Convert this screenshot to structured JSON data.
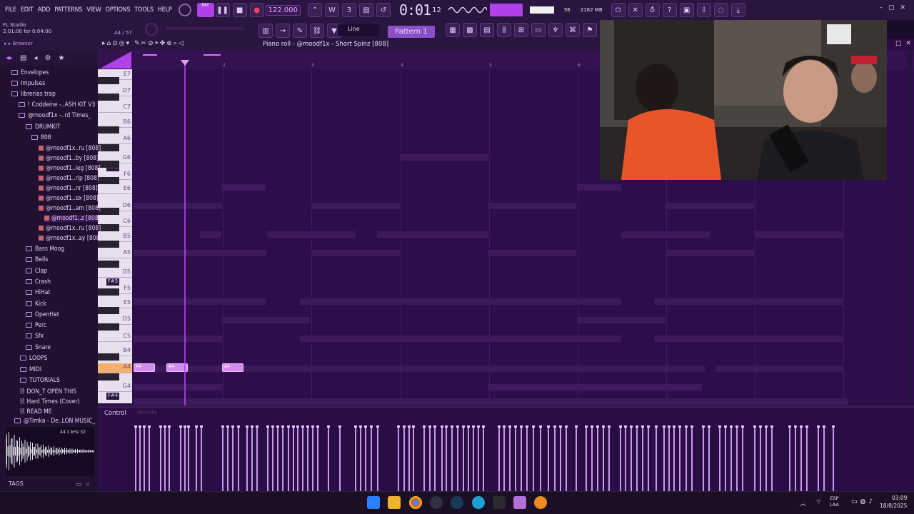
{
  "menu": [
    "FILE",
    "EDIT",
    "ADD",
    "PATTERNS",
    "VIEW",
    "OPTIONS",
    "TOOLS",
    "HELP"
  ],
  "transport": {
    "tempo": "122.000",
    "time": "0:01",
    "time_small": "12",
    "pattern": "Pattern 1",
    "snap": "Line",
    "cpu": "56",
    "mem": "2182 MB",
    "mem_small": "11"
  },
  "hint": {
    "line1": "FL Studio",
    "line2": "2:01:00 for 0:04:00",
    "step": "A4 / 57"
  },
  "browser": {
    "title": "Browser",
    "items": [
      {
        "label": "Envelopes",
        "type": "folder"
      },
      {
        "label": "Impulses",
        "type": "folder"
      },
      {
        "label": "librerias trap",
        "type": "folder"
      },
      {
        "label": "! Coddeine -..ASH KIT V3 !",
        "type": "folder"
      },
      {
        "label": "@moodf1x -..rd Times_",
        "type": "folder"
      },
      {
        "label": "DRUMKIT",
        "type": "folder"
      },
      {
        "label": "808",
        "type": "folder"
      },
      {
        "label": "@moodf1x..ru [808]",
        "type": "file"
      },
      {
        "label": "@moodf1..by [808]",
        "type": "file"
      },
      {
        "label": "@moodf1..leg [808]",
        "type": "file"
      },
      {
        "label": "@moodf1..rip [808]",
        "type": "file"
      },
      {
        "label": "@moodf1..nr [808]",
        "type": "file"
      },
      {
        "label": "@moodf1..ex [808]",
        "type": "file"
      },
      {
        "label": "@moodf1..am [808]",
        "type": "file"
      },
      {
        "label": "@moodf1..z [808]",
        "type": "file"
      },
      {
        "label": "@moodf1x..ru [808]",
        "type": "file"
      },
      {
        "label": "@moodf1x..ay [808]",
        "type": "file"
      },
      {
        "label": "Bass Moog",
        "type": "folder"
      },
      {
        "label": "Bells",
        "type": "folder"
      },
      {
        "label": "Clap",
        "type": "folder"
      },
      {
        "label": "Crash",
        "type": "folder"
      },
      {
        "label": "HiHat",
        "type": "folder"
      },
      {
        "label": "Kick",
        "type": "folder"
      },
      {
        "label": "OpenHat",
        "type": "folder"
      },
      {
        "label": "Perc",
        "type": "folder"
      },
      {
        "label": "Sfx",
        "type": "folder"
      },
      {
        "label": "Snare",
        "type": "folder"
      },
      {
        "label": "LOOPS",
        "type": "folder"
      },
      {
        "label": "MIDI",
        "type": "folder"
      },
      {
        "label": "TUTORIALS",
        "type": "folder"
      },
      {
        "label": "DON_T OPEN THIS",
        "type": "doc"
      },
      {
        "label": "Hard Times (Cover)",
        "type": "doc"
      },
      {
        "label": "READ ME",
        "type": "doc"
      },
      {
        "label": "@Timka - De..LON MUSIC_",
        "type": "folder"
      }
    ],
    "sample_info": "44.1 kHz 32",
    "tags": "TAGS"
  },
  "pianoroll": {
    "title": "Piano roll - @moodf1x - Short Spinz [808]",
    "bars": [
      "2",
      "3",
      "4",
      "5",
      "6"
    ],
    "keys": [
      "E7",
      "D7",
      "C7",
      "B6",
      "A6",
      "G6",
      "F#6",
      "F6",
      "E6",
      "D6",
      "C6",
      "B5",
      "A5",
      "G5",
      "F#5",
      "F5",
      "E5",
      "D5",
      "C5",
      "B4",
      "A4",
      "G4",
      "F#4"
    ],
    "note_label": "A4",
    "control_label": "Control",
    "control_sub": "Velocity"
  },
  "taskbar": {
    "lang1": "ESP",
    "lang2": "LAA",
    "time": "03:09",
    "date": "18/8/2025"
  },
  "colors": {
    "accent": "#c040ff",
    "note": "#d48cf0",
    "bg": "#2e0e4a"
  }
}
